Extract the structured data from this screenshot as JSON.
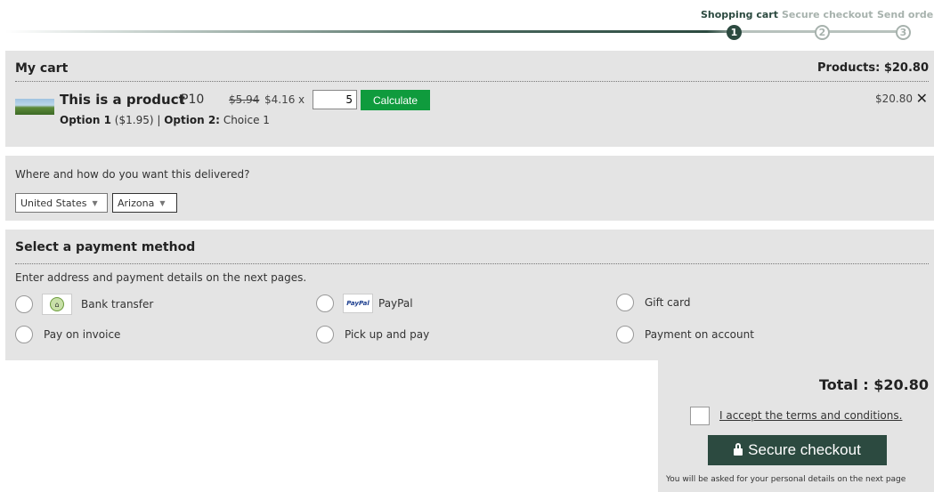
{
  "steps": [
    {
      "label": "Shopping cart",
      "number": "1",
      "active": true
    },
    {
      "label": "Secure checkout",
      "number": "2",
      "active": false
    },
    {
      "label": "Send order",
      "number": "3",
      "active": false
    }
  ],
  "cart": {
    "heading": "My cart",
    "products_total": "Products: $20.80",
    "item": {
      "name": "This is a product",
      "sku": "P10",
      "old_price": "$5.94",
      "price": "$4.16",
      "times": "x",
      "quantity": "5",
      "calculate_label": "Calculate",
      "line_total": "$20.80",
      "remove_icon": "close-icon",
      "option1_label": "Option 1",
      "option1_value": "($1.95)",
      "separator": "|",
      "option2_label": "Option 2:",
      "option2_value": "Choice 1"
    }
  },
  "delivery": {
    "question": "Where and how do you want this delivered?",
    "country": "United States",
    "state": "Arizona"
  },
  "payment": {
    "heading": "Select a payment method",
    "note": "Enter address and payment details on the next pages.",
    "options": {
      "bank": "Bank transfer",
      "paypal": "PayPal",
      "gift": "Gift card",
      "invoice": "Pay on invoice",
      "pickup": "Pick up and pay",
      "account": "Payment on account"
    },
    "paypal_logo_text": "PayPal"
  },
  "summary": {
    "total": "Total :  $20.80",
    "terms": "I accept the terms and conditions.",
    "checkout_label": "Secure checkout",
    "checkout_note": "You will be asked for your personal details on the next page"
  },
  "colors": {
    "accent": "#2c4a40",
    "calculate": "#0f9b3d",
    "panel": "#e4e4e4"
  }
}
